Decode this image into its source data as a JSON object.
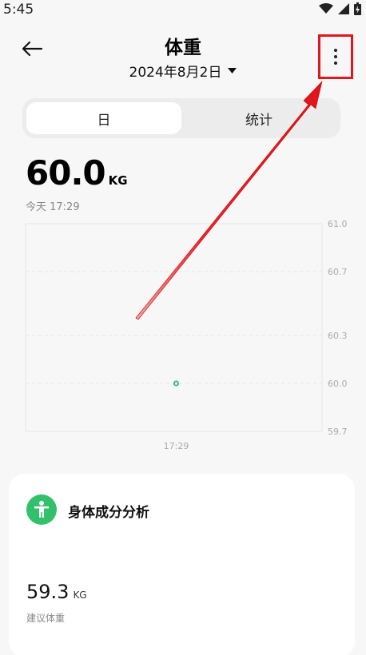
{
  "status_bar": {
    "time": "5:45"
  },
  "header": {
    "title": "体重",
    "date": "2024年8月2日"
  },
  "tabs": [
    {
      "label": "日",
      "selected": true
    },
    {
      "label": "统计",
      "selected": false
    }
  ],
  "reading": {
    "value": "60.0",
    "unit": "KG",
    "time": "今天 17:29"
  },
  "chart_data": {
    "type": "scatter",
    "title": "",
    "xlabel": "",
    "ylabel": "",
    "x_ticks": [
      "17:29"
    ],
    "y_ticks": [
      "61.0",
      "60.7",
      "60.3",
      "60.0",
      "59.7"
    ],
    "ylim": [
      59.7,
      61.0
    ],
    "points": [
      {
        "x": "17:29",
        "y": 60.0
      }
    ],
    "point_color": "#34c36b",
    "y_axis_position": "right",
    "grid": true
  },
  "analysis_card": {
    "title": "身体成分分析",
    "value": "59.3",
    "unit": "KG",
    "label": "建议体重"
  },
  "colors": {
    "accent": "#33c06a",
    "highlight": "#e3161d"
  },
  "icons": {
    "back": "arrow-left-icon",
    "more": "more-vertical-icon",
    "dropdown": "triangle-down-icon",
    "body": "person-icon"
  }
}
